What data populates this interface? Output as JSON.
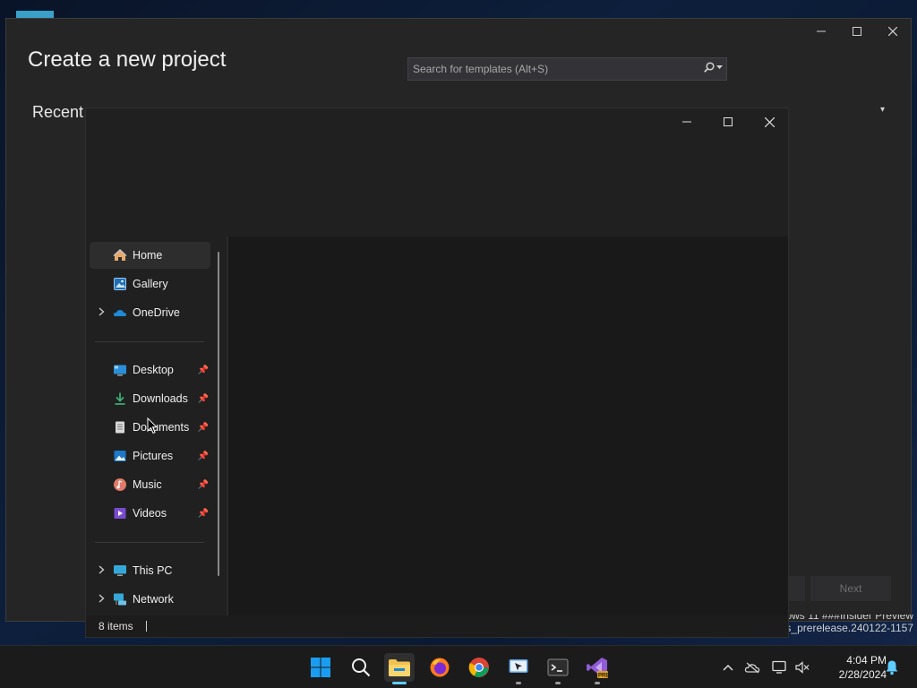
{
  "vs": {
    "title": "Create a new project",
    "search_placeholder": "Search for templates (Alt+S)",
    "recent_label": "Recent",
    "next_label": "Next"
  },
  "explorer": {
    "nav": [
      {
        "label": "Home",
        "icon": "home-icon",
        "selected": true
      },
      {
        "label": "Gallery",
        "icon": "gallery-icon"
      },
      {
        "label": "OneDrive",
        "icon": "onedrive-icon"
      },
      {
        "label": "Desktop",
        "icon": "desktop-icon",
        "pinned": true
      },
      {
        "label": "Downloads",
        "icon": "downloads-icon",
        "pinned": true
      },
      {
        "label": "Documents",
        "icon": "documents-icon",
        "pinned": true
      },
      {
        "label": "Pictures",
        "icon": "pictures-icon",
        "pinned": true
      },
      {
        "label": "Music",
        "icon": "music-icon",
        "pinned": true
      },
      {
        "label": "Videos",
        "icon": "videos-icon",
        "pinned": true
      },
      {
        "label": "This PC",
        "icon": "this-pc-icon"
      },
      {
        "label": "Network",
        "icon": "network-icon"
      }
    ],
    "status": "8 items"
  },
  "watermark": {
    "line1": "ows 11 ###Insider Preview",
    "line2": "rs_prerelease.240122-1157"
  },
  "taskbar": {
    "time": "4:04 PM",
    "date": "2/28/2024"
  },
  "colors": {
    "accent": "#60cdff",
    "windows_blue": "#0078d4",
    "folder_yellow": "#f2c14e"
  }
}
